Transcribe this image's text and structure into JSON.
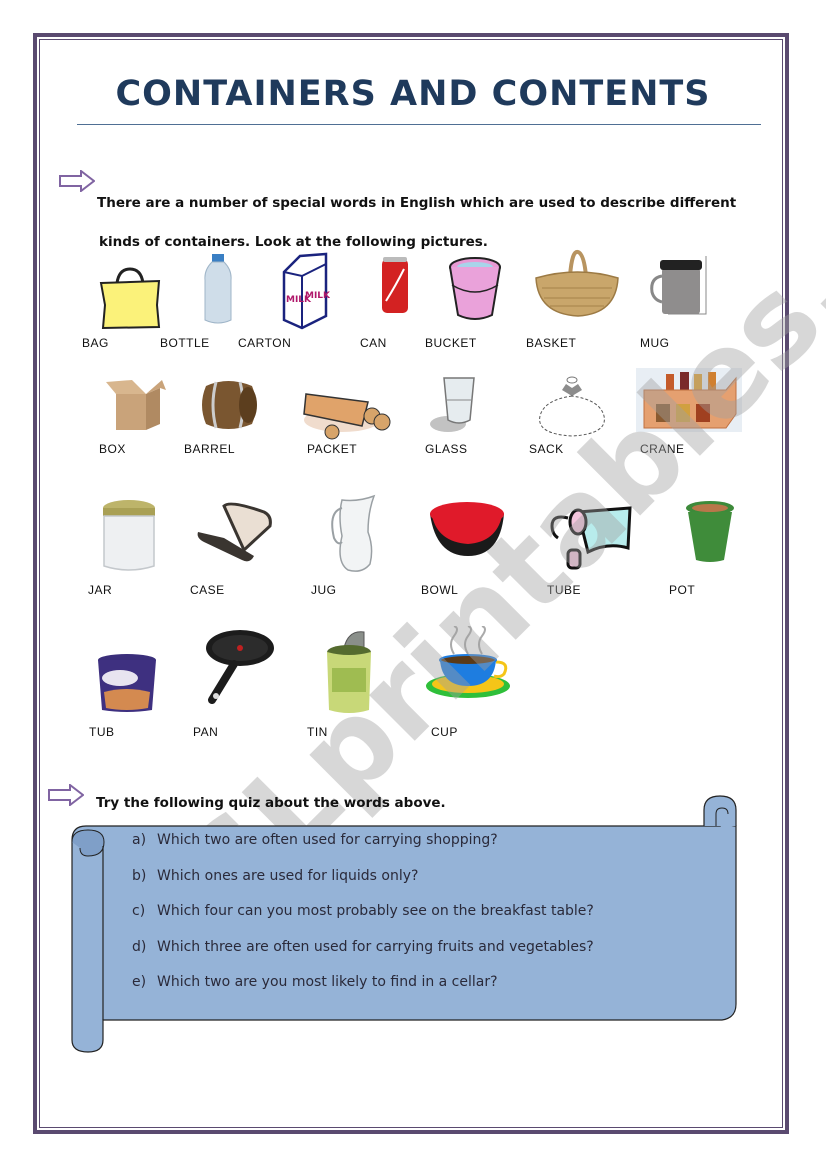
{
  "title": "CONTAINERS AND CONTENTS",
  "intro": {
    "line1": "There are a number of special words in English which are used to describe different",
    "line2": "kinds of containers. Look at the following pictures."
  },
  "items": [
    {
      "label": "BAG",
      "icon": "bag-icon"
    },
    {
      "label": "BOTTLE",
      "icon": "bottle-icon"
    },
    {
      "label": "CARTON",
      "icon": "carton-icon"
    },
    {
      "label": "CAN",
      "icon": "can-icon"
    },
    {
      "label": "BUCKET",
      "icon": "bucket-icon"
    },
    {
      "label": "BASKET",
      "icon": "basket-icon"
    },
    {
      "label": "MUG",
      "icon": "mug-icon"
    },
    {
      "label": "BOX",
      "icon": "box-icon"
    },
    {
      "label": "BARREL",
      "icon": "barrel-icon"
    },
    {
      "label": "PACKET",
      "icon": "packet-icon"
    },
    {
      "label": "GLASS",
      "icon": "glass-icon"
    },
    {
      "label": "SACK",
      "icon": "sack-icon"
    },
    {
      "label": "CRANE",
      "icon": "crate-icon"
    },
    {
      "label": "JAR",
      "icon": "jar-icon"
    },
    {
      "label": "CASE",
      "icon": "case-icon"
    },
    {
      "label": "JUG",
      "icon": "jug-icon"
    },
    {
      "label": "BOWL",
      "icon": "bowl-icon"
    },
    {
      "label": "TUBE",
      "icon": "tube-icon"
    },
    {
      "label": "POT",
      "icon": "pot-icon"
    },
    {
      "label": "TUB",
      "icon": "tub-icon"
    },
    {
      "label": "PAN",
      "icon": "pan-icon"
    },
    {
      "label": "TIN",
      "icon": "tin-icon"
    },
    {
      "label": "CUP",
      "icon": "cup-icon"
    }
  ],
  "quiz": {
    "intro": "Try the following quiz about the words above.",
    "questions": [
      {
        "letter": "a)",
        "text": "Which two are often used for carrying shopping?"
      },
      {
        "letter": "b)",
        "text": "Which ones are used for liquids only?"
      },
      {
        "letter": "c)",
        "text": "Which four can you most probably see on the breakfast table?"
      },
      {
        "letter": "d)",
        "text": "Which three are often used for carrying fruits and vegetables?"
      },
      {
        "letter": "e)",
        "text": "Which two are you most likely to find in a cellar?"
      }
    ]
  },
  "watermark": "ESLprintables.com",
  "colors": {
    "frame": "#5a4a70",
    "title": "#1f3a5c",
    "scroll": "#95b3d7",
    "arrow": "#8064a2"
  }
}
